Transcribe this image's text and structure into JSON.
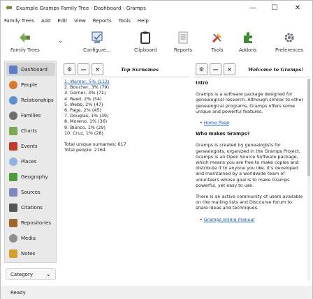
{
  "window": {
    "title": "Example Gramps Family Tree - Dashboard - Gramps",
    "controls": {
      "minimize": "—",
      "maximize": "☐",
      "close": "✕"
    }
  },
  "menubar": [
    "Family Trees",
    "Add",
    "Edit",
    "View",
    "Reports",
    "Tools",
    "Help"
  ],
  "toolbar": {
    "family_trees": "Family Trees",
    "configure": "Configure...",
    "clipboard": "Clipboard",
    "reports": "Reports",
    "tools": "Tools",
    "addons": "Addons",
    "preferences": "Preferences"
  },
  "sidebar": {
    "items": [
      {
        "label": "Dashboard",
        "icon": "dashboard-icon",
        "color": "#5a7ec8",
        "active": true
      },
      {
        "label": "People",
        "icon": "person-icon",
        "color": "#d9772a"
      },
      {
        "label": "Relationships",
        "icon": "relationships-icon",
        "color": "#5c8fd6"
      },
      {
        "label": "Families",
        "icon": "family-icon",
        "color": "#6d6d6d"
      },
      {
        "label": "Charts",
        "icon": "charts-icon",
        "color": "#7aa74f"
      },
      {
        "label": "Events",
        "icon": "events-icon",
        "color": "#c0392b"
      },
      {
        "label": "Places",
        "icon": "places-icon",
        "color": "#8fb4e0"
      },
      {
        "label": "Geography",
        "icon": "geography-icon",
        "color": "#4c9b3c"
      },
      {
        "label": "Sources",
        "icon": "sources-icon",
        "color": "#7d88c0"
      },
      {
        "label": "Citations",
        "icon": "citations-icon",
        "color": "#555555"
      },
      {
        "label": "Repositories",
        "icon": "repositories-icon",
        "color": "#a0672c"
      },
      {
        "label": "Media",
        "icon": "media-icon",
        "color": "#8d8d8d"
      },
      {
        "label": "Notes",
        "icon": "notes-icon",
        "color": "#d4a02a"
      }
    ],
    "category_label": "Category"
  },
  "status": {
    "text": "Ready"
  },
  "surnames": {
    "title": "Top Surnames",
    "first_entry": "1. Warner, 5% (112)",
    "entries": [
      "2. Boucher, 3% (79)",
      "3. Garner, 3% (71)",
      "4. Reed, 2% (54)",
      "5. Webb, 2% (47)",
      "6. Page, 2% (45)",
      "7. Douglas, 1% (39)",
      "8. Moreno, 1% (36)",
      "9. Blanco, 1% (29)",
      "10. Cruz, 1% (28)"
    ],
    "total_surnames": "Total unique surnames: 617",
    "total_people": "Total people: 2164"
  },
  "welcome": {
    "title": "Welcome to Gramps!",
    "intro_heading": "Intro",
    "intro_text": "Gramps is a software package designed for genealogical research. Although similar to other genealogical programs, Gramps offers some unique and powerful features.",
    "home_page_link": "Home Page",
    "who_heading": "Who makes Gramps?",
    "who_text": "Gramps is created by genealogists for genealogists, organized in the Gramps Project. Gramps is an Open Source Software package, which means you are free to make copies and distribute it to anyone you like. It's developed and maintained by a worldwide team of volunteers whose goal is to make Gramps powerful, yet easy to use.",
    "community_text": "There is an active community of users available on the mailing lists and Discourse forum to share ideas and techniques.",
    "manual_link": "Gramps online manual"
  },
  "gramplet_buttons": {
    "properties": "⚙",
    "minimize": "—",
    "close": "×"
  }
}
